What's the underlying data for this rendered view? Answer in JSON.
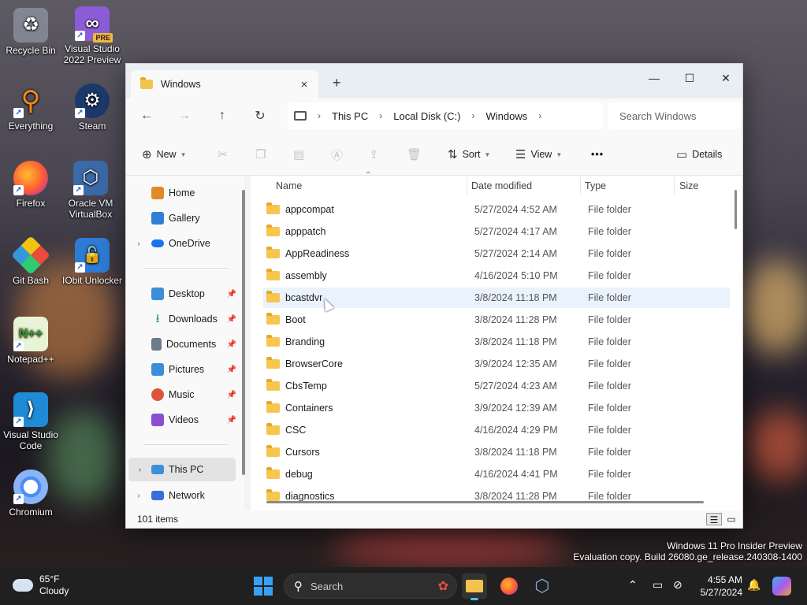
{
  "desktop": {
    "icons": [
      {
        "label": "Recycle Bin",
        "icon": "recycle-bin-icon"
      },
      {
        "label": "Visual Studio 2022 Preview",
        "icon": "visual-studio-icon",
        "badge": "PRE"
      },
      {
        "label": "Everything",
        "icon": "everything-search-icon"
      },
      {
        "label": "Steam",
        "icon": "steam-icon"
      },
      {
        "label": "Firefox",
        "icon": "firefox-icon"
      },
      {
        "label": "Oracle VM VirtualBox",
        "icon": "virtualbox-icon"
      },
      {
        "label": "Git Bash",
        "icon": "git-bash-icon"
      },
      {
        "label": "IObit Unlocker",
        "icon": "iobit-unlocker-icon"
      },
      {
        "label": "Notepad++",
        "icon": "notepad-plus-plus-icon"
      },
      {
        "label": "Visual Studio Code",
        "icon": "vscode-icon"
      },
      {
        "label": "Chromium",
        "icon": "chromium-icon"
      }
    ],
    "watermark_line1": "Windows 11 Pro Insider Preview",
    "watermark_line2": "Evaluation copy. Build 26080.ge_release.240308-1400"
  },
  "explorer": {
    "tab_title": "Windows",
    "tab_close": "×",
    "new_tab": "+",
    "window_controls": {
      "minimize": "—",
      "maximize": "☐",
      "close": "✕"
    },
    "nav": {
      "back": "←",
      "forward": "→",
      "up": "↑",
      "refresh": "↻"
    },
    "breadcrumb": [
      "This PC",
      "Local Disk (C:)",
      "Windows"
    ],
    "search_placeholder": "Search Windows",
    "commands": {
      "new": "New",
      "sort": "Sort",
      "view": "View",
      "more": "•••",
      "details": "Details"
    },
    "sidebar": [
      {
        "label": "Home",
        "icon": "home-icon",
        "color": "#e08a2c"
      },
      {
        "label": "Gallery",
        "icon": "gallery-icon",
        "color": "#2f7fd6"
      },
      {
        "label": "OneDrive",
        "icon": "onedrive-icon",
        "color": "#1a73e8"
      },
      {
        "label": "Desktop",
        "icon": "desktop-icon",
        "color": "#3a8fd8"
      },
      {
        "label": "Downloads",
        "icon": "downloads-icon",
        "color": "#2aa05a"
      },
      {
        "label": "Documents",
        "icon": "documents-icon",
        "color": "#6c7a8a"
      },
      {
        "label": "Pictures",
        "icon": "pictures-icon",
        "color": "#3a8fd8"
      },
      {
        "label": "Music",
        "icon": "music-icon",
        "color": "#e0533b"
      },
      {
        "label": "Videos",
        "icon": "videos-icon",
        "color": "#8a4fd1"
      },
      {
        "label": "This PC",
        "icon": "this-pc-icon",
        "color": "#3a8fd8"
      },
      {
        "label": "Network",
        "icon": "network-icon",
        "color": "#3a6fd8"
      }
    ],
    "columns": {
      "name": "Name",
      "date": "Date modified",
      "type": "Type",
      "size": "Size"
    },
    "rows": [
      {
        "name": "appcompat",
        "date": "5/27/2024 4:52 AM",
        "type": "File folder"
      },
      {
        "name": "apppatch",
        "date": "5/27/2024 4:17 AM",
        "type": "File folder"
      },
      {
        "name": "AppReadiness",
        "date": "5/27/2024 2:14 AM",
        "type": "File folder"
      },
      {
        "name": "assembly",
        "date": "4/16/2024 5:10 PM",
        "type": "File folder"
      },
      {
        "name": "bcastdvr",
        "date": "3/8/2024 11:18 PM",
        "type": "File folder"
      },
      {
        "name": "Boot",
        "date": "3/8/2024 11:28 PM",
        "type": "File folder"
      },
      {
        "name": "Branding",
        "date": "3/8/2024 11:18 PM",
        "type": "File folder"
      },
      {
        "name": "BrowserCore",
        "date": "3/9/2024 12:35 AM",
        "type": "File folder"
      },
      {
        "name": "CbsTemp",
        "date": "5/27/2024 4:23 AM",
        "type": "File folder"
      },
      {
        "name": "Containers",
        "date": "3/9/2024 12:39 AM",
        "type": "File folder"
      },
      {
        "name": "CSC",
        "date": "4/16/2024 4:29 PM",
        "type": "File folder"
      },
      {
        "name": "Cursors",
        "date": "3/8/2024 11:18 PM",
        "type": "File folder"
      },
      {
        "name": "debug",
        "date": "4/16/2024 4:41 PM",
        "type": "File folder"
      },
      {
        "name": "diagnostics",
        "date": "3/8/2024 11:28 PM",
        "type": "File folder"
      }
    ],
    "status": "101 items"
  },
  "taskbar": {
    "weather_temp": "65°F",
    "weather_desc": "Cloudy",
    "search_label": "Search",
    "time": "4:55 AM",
    "date": "5/27/2024"
  }
}
